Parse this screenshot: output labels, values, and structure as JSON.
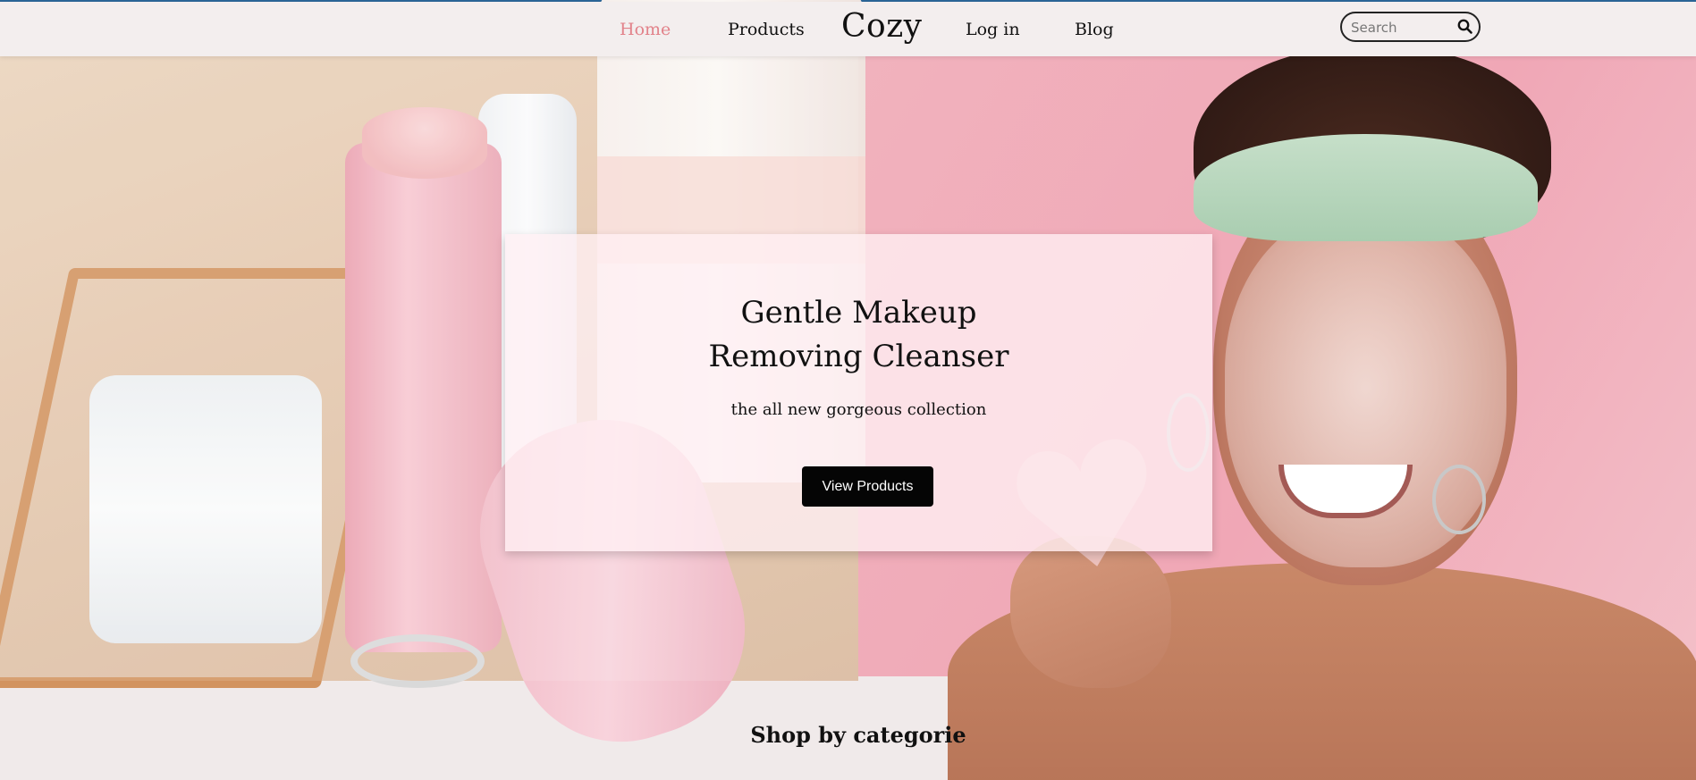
{
  "nav": {
    "home": "Home",
    "products": "Products",
    "brand": "Cozy",
    "login": "Log in",
    "blog": "Blog",
    "active_color": "#e2828a"
  },
  "search": {
    "placeholder": "Search",
    "value": "",
    "icon": "search-icon"
  },
  "hero": {
    "title_line1": "Gentle Makeup",
    "title_line2": "Removing Cleanser",
    "subtitle": "the all new gorgeous collection",
    "button": "View Products"
  },
  "sections": {
    "shop_title": "Shop by categorie"
  },
  "colors": {
    "accent_pink": "#e2828a",
    "button_bg": "#050505",
    "page_bg": "#f0eaea"
  }
}
